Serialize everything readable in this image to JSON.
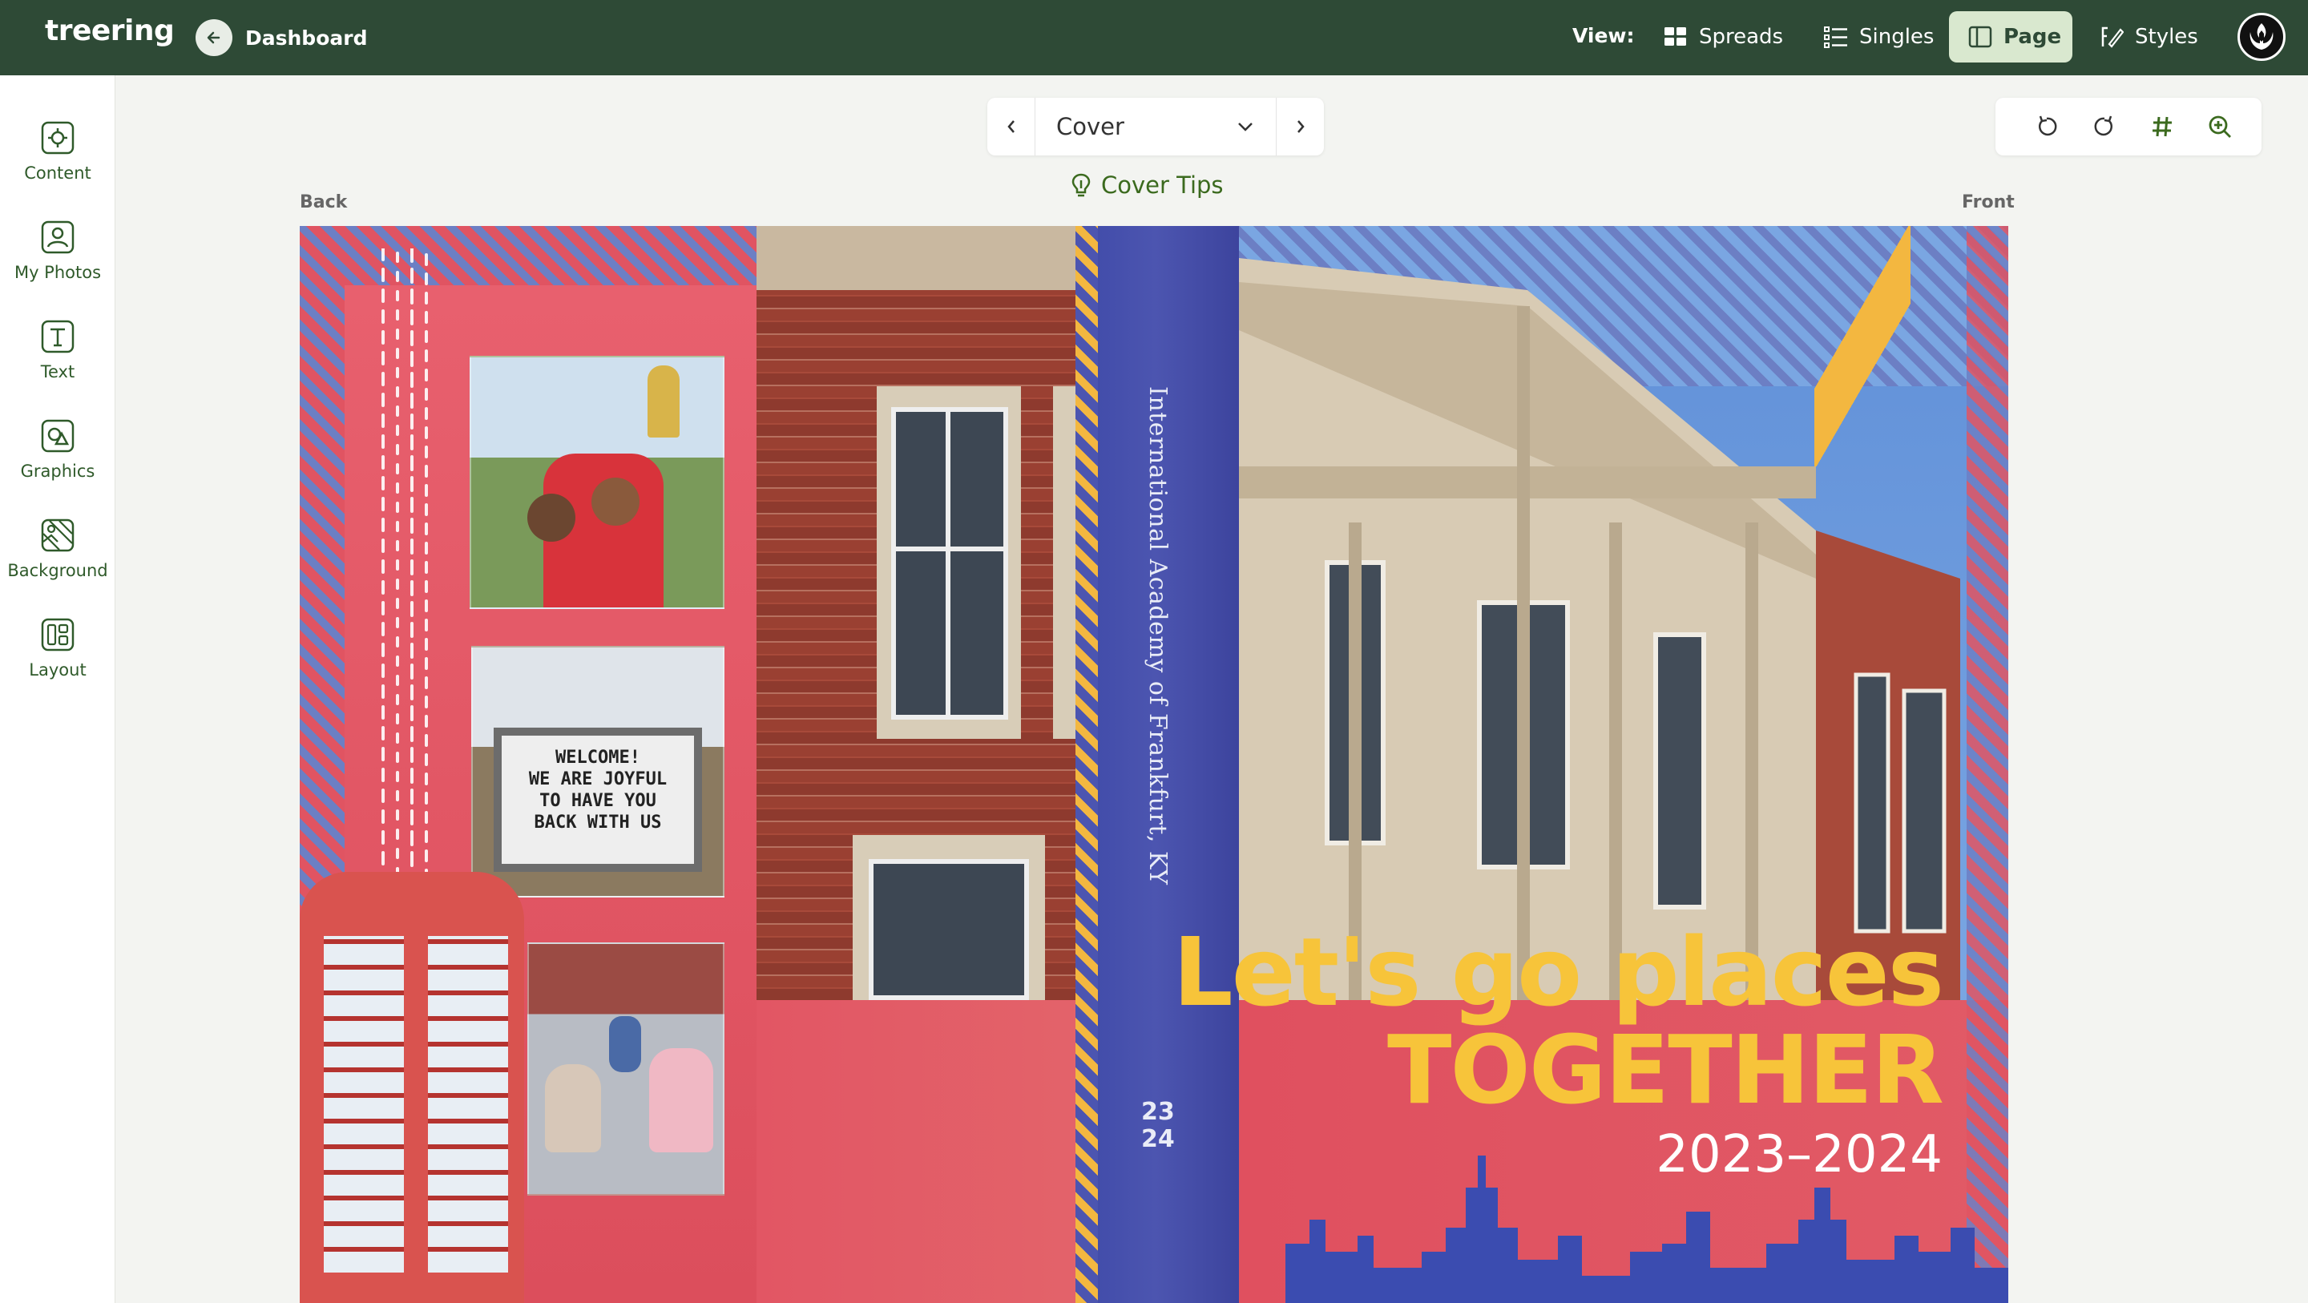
{
  "app": {
    "logo": "treering"
  },
  "header": {
    "back_label": "Dashboard",
    "view_label": "View:",
    "views": [
      {
        "label": "Spreads",
        "icon": "grid-icon",
        "active": false
      },
      {
        "label": "Singles",
        "icon": "list-icon",
        "active": false
      },
      {
        "label": "Page",
        "icon": "page-icon",
        "active": true
      },
      {
        "label": "Styles",
        "icon": "brush-icon",
        "active": false
      }
    ],
    "avatar_icon": "rebel-alliance-icon"
  },
  "sidebar": {
    "items": [
      {
        "label": "Content",
        "icon": "content-icon"
      },
      {
        "label": "My Photos",
        "icon": "photos-icon"
      },
      {
        "label": "Text",
        "icon": "text-icon"
      },
      {
        "label": "Graphics",
        "icon": "graphics-icon"
      },
      {
        "label": "Background",
        "icon": "background-icon"
      },
      {
        "label": "Layout",
        "icon": "layout-icon"
      }
    ]
  },
  "page_nav": {
    "current": "Cover"
  },
  "tools": [
    "undo-icon",
    "redo-icon",
    "grid-hash-icon",
    "zoom-in-icon"
  ],
  "tips_label": "Cover Tips",
  "labels": {
    "back": "Back",
    "front": "Front"
  },
  "cover": {
    "headline_line1": "Let's go places",
    "headline_line2": "TOGETHER",
    "year": "2023–2024",
    "spine_title": "International Academy of Frankfurt, KY",
    "spine_year_top": "23",
    "spine_year_bottom": "24",
    "sign_lines": [
      "WELCOME!",
      "WE ARE JOYFUL",
      "TO HAVE YOU",
      "BACK WITH US"
    ]
  },
  "colors": {
    "topbar": "#2e4a36",
    "accent_green": "#3b6a1e",
    "cover_red": "#e05462",
    "headline_yellow": "#f7c43a",
    "spine_blue": "#4a4fa6"
  }
}
